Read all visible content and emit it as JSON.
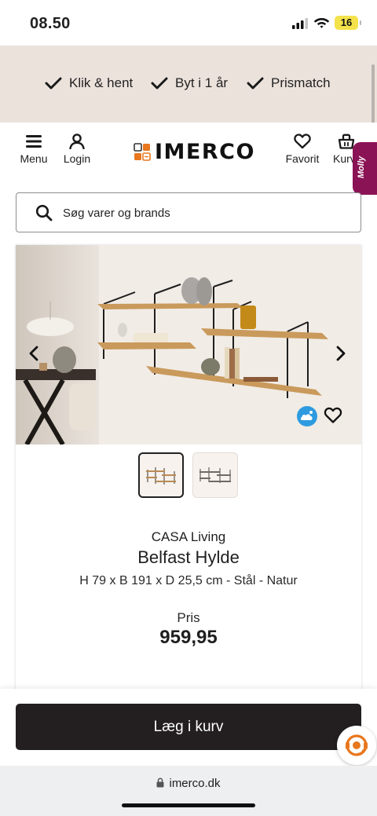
{
  "status_bar": {
    "time": "08.50",
    "battery": "16"
  },
  "usp": [
    {
      "label": "Klik & hent",
      "icon": "check-icon"
    },
    {
      "label": "Byt i 1 år",
      "icon": "check-icon"
    },
    {
      "label": "Prismatch",
      "icon": "check-icon"
    }
  ],
  "header": {
    "menu_label": "Menu",
    "login_label": "Login",
    "logo_text": "IMERCO",
    "favorites_label": "Favorit",
    "cart_label": "Kurv",
    "chat_tab": "Molly"
  },
  "search": {
    "placeholder": "Søg varer og brands"
  },
  "product": {
    "brand": "CASA Living",
    "name": "Belfast Hylde",
    "description": "H 79 x B 191 x D 25,5 cm - Stål - Natur",
    "price_label": "Pris",
    "price": "959,95"
  },
  "actions": {
    "add_to_cart": "Læg i kurv"
  },
  "browser": {
    "url": "imerco.dk"
  },
  "colors": {
    "banner_bg": "#ece2dc",
    "primary_button": "#231f20",
    "chat_tab": "#8a1356",
    "accent_orange": "#e8771e"
  }
}
